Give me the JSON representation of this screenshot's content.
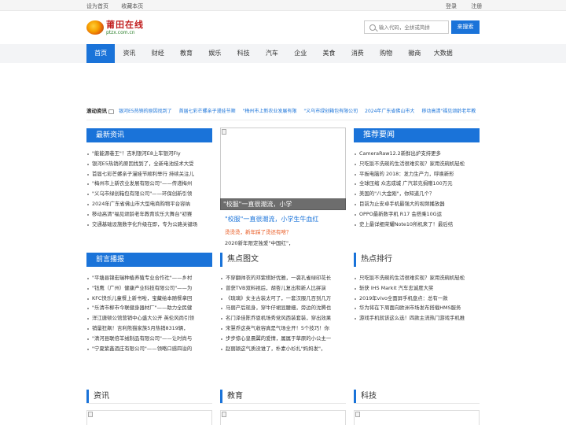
{
  "topbar": {
    "left": [
      "设为首页",
      "收藏本页"
    ],
    "right": [
      "登录",
      "注册"
    ]
  },
  "logo": {
    "cn": "莆田在线",
    "en": "ptzx.com.cn"
  },
  "search": {
    "placeholder": "输入代码，全拼或简拼",
    "button": "来搜索"
  },
  "nav": [
    "首页",
    "资讯",
    "财经",
    "教育",
    "娱乐",
    "科技",
    "汽车",
    "企业",
    "美食",
    "消费",
    "购物",
    "徽商",
    "大数据"
  ],
  "ticker": {
    "title": "滚动资讯",
    "items": [
      "银河E5热销的原因找到了",
      "首届七彩芒螺亲子漫娃节顺",
      "\"梅州市上新农业发展有限",
      "\"义乌市绿创箱包有限公司",
      "2024年广东省佛山市大",
      "移动高清\"福见颂龄老年教"
    ]
  },
  "latest": {
    "title": "最新资讯",
    "items": [
      "\"能能源巷王\"！吉利银河E8上车银河Fly",
      "银河E5热销的原因找到了，全新电池技术大受",
      "首届七彩芒螺亲子漫娃节顺利举行 持续关注儿",
      "\"梅州市上新农业发展有限公司\"——传递梅州",
      "\"义乌市绿创箱包有限公司\"——环保创新引领",
      "2024年广东省佛山市大型电商购物平台容纳",
      "移动高清\"福见颂龄老年教育欢乐大舞台\"初赛",
      "交通基础设施数字化升级在即，专为公路关键场"
    ]
  },
  "feature": {
    "caption": "\"校服\"一直很潮流，小学",
    "title": "\"校服\"一直很潮流，小学生牛血红",
    "sub": "烫烫烫，新年踩了烫还有啥？",
    "more": "2020新年限定独爱\"中国红\"，"
  },
  "hot": {
    "title": "推荐要闻",
    "items": [
      "CameraRaw12.2新鲜出炉支持更多",
      "只吃饭不洗碗的生活很难实现？家用洗碗机轻松",
      "平板电脑的 2018：发力生产力，呼唤新形",
      "全球压缩 众志成城 广汽菲克捐赠100万元",
      "美国的\"八大金刚\"，你知道几个？",
      "目前为止安卓手机最强大的视频播放器",
      "OPPO最新数字机 R17 会搭乘10G运",
      "史上最详细荣耀Note10所机来了！最后结"
    ]
  },
  "prelude": {
    "title": "前言播报",
    "items": [
      "\"平塘县锦宏瑞种植养殖专业合作社\"——乡村",
      "\"钰鹰（广州）健康产业科技有限公司\"——为",
      "KFC快乐儿童餐上新书啦，宝藏绘本随餐拿回",
      "\"乐清市柳市今联健身器材厂\"——助力全民健",
      "洋江唐顿公馆营销中心盛大公开 英伦风尚引领",
      "销量狂飙！吉利熊猫家族5月热销8319辆，",
      "\"清河县联倍羊绒制品有限公司\"——让时尚与",
      "\"宁夏紫鑫酒庄有限公司\"——领略口感四溢的"
    ]
  },
  "focus": {
    "title": "焦点图文",
    "items": [
      "不穿翻帅衣的邓紫棋好优雅，一袭孔雀绿印花长",
      "曾获TVB双料视后，胡杏儿复出和新人比拼演",
      "《琉璃》女主古装太可了，一套汉服几百到几万",
      "马丽产后现身，穿牛仔裙显腰细，旁边的沈腾也",
      "名门泽佳陈乔恩机场秀党风西装套装，穿出效果",
      "宋慧乔这英气收容真是气场全开！5个技巧！你",
      "步步惊心皇晨翼的爱情，属属于草原的小公主一",
      "赵丽颖这气质没谁了，朴素小衫扎\"妈妈发\"，"
    ]
  },
  "ranking": {
    "title": "热点排行",
    "items": [
      "只吃饭不洗碗的生活很难实现？家用洗碗机轻松",
      "斩获 IHS Markit 汽车忠诚度大奖",
      "2019年vivo全面屏手机盘点：总有一款",
      "华为将在下周面向欧洲市场发布搭载HMS服务",
      "游戏手机就该这么选！四款主流热门游戏手机推"
    ]
  },
  "sections": [
    "资讯",
    "教育",
    "科技"
  ]
}
